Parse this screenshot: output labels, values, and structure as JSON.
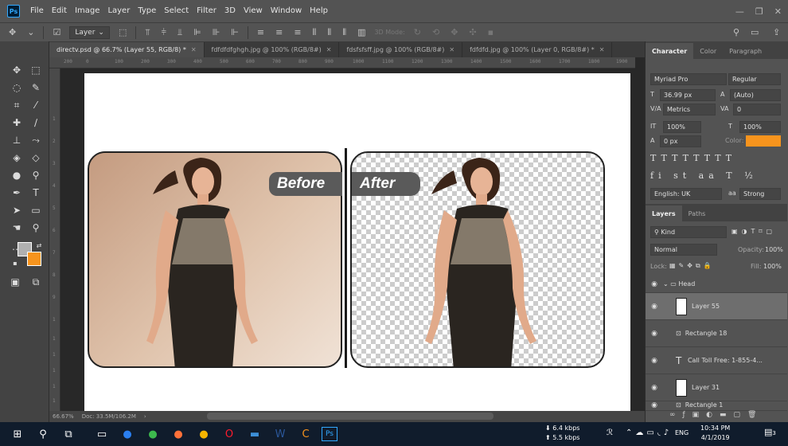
{
  "menubar": {
    "logo": "Ps",
    "items": [
      "File",
      "Edit",
      "Image",
      "Layer",
      "Type",
      "Select",
      "Filter",
      "3D",
      "View",
      "Window",
      "Help"
    ]
  },
  "optbar": {
    "layer_select": "Layer",
    "mode_3d": "3D Mode:"
  },
  "tabs": [
    {
      "label": "directv.psd @ 66.7% (Layer 55, RGB/8) *",
      "active": true
    },
    {
      "label": "fdfdfdfghgh.jpg @ 100% (RGB/8#)",
      "active": false
    },
    {
      "label": "fdsfsfsff.jpg @ 100% (RGB/8#)",
      "active": false
    },
    {
      "label": "fdfdfd.jpg @ 100% (Layer 0, RGB/8#) *",
      "active": false
    }
  ],
  "ruler": {
    "h_ticks": [
      "200",
      "0",
      "100",
      "200",
      "300",
      "400",
      "500",
      "600",
      "700",
      "800",
      "900",
      "1000",
      "1100",
      "1200",
      "1300",
      "1400",
      "1500",
      "1600",
      "1700",
      "1800",
      "1900"
    ],
    "v_ticks": [
      "1",
      "2",
      "3",
      "4",
      "5",
      "6",
      "7",
      "8",
      "9",
      "1",
      "1",
      "1",
      "1",
      "1",
      "1",
      "1"
    ]
  },
  "canvas": {
    "before_label": "Before",
    "after_label": "After"
  },
  "status": {
    "zoom": "66.67%",
    "doc": "Doc: 33.5M/106.2M"
  },
  "character": {
    "tabs": [
      "Character",
      "Color",
      "Paragraph"
    ],
    "font": "Myriad Pro",
    "style": "Regular",
    "size": "36.99 px",
    "leading": "(Auto)",
    "kerning": "Metrics",
    "tracking": "0",
    "vscale": "100%",
    "hscale": "100%",
    "baseline": "0 px",
    "color_label": "Color:",
    "color_value": "#f7941d",
    "language": "English: UK",
    "aa_symbol": "aa",
    "aa": "Strong"
  },
  "layers": {
    "tabs": [
      "Layers",
      "Paths"
    ],
    "filter": "Kind",
    "blend": "Normal",
    "opacity_label": "Opacity:",
    "opacity": "100%",
    "lock_label": "Lock:",
    "fill_label": "Fill:",
    "fill": "100%",
    "items": [
      {
        "name": "Head",
        "type": "group",
        "active": false
      },
      {
        "name": "Layer 55",
        "type": "pixel",
        "active": true
      },
      {
        "name": "Rectangle 18",
        "type": "shape",
        "active": false
      },
      {
        "name": "Call Toll Free: 1-855-4...",
        "type": "text",
        "active": false
      },
      {
        "name": "Layer 31",
        "type": "pixel",
        "active": false
      },
      {
        "name": "Rectangle 1",
        "type": "shape",
        "active": false
      }
    ]
  },
  "taskbar": {
    "net_down": "6.4 kbps",
    "net_up": "5.5 kbps",
    "lang": "ENG",
    "time": "10:34 PM",
    "date": "4/1/2019",
    "notif_count": "3"
  }
}
